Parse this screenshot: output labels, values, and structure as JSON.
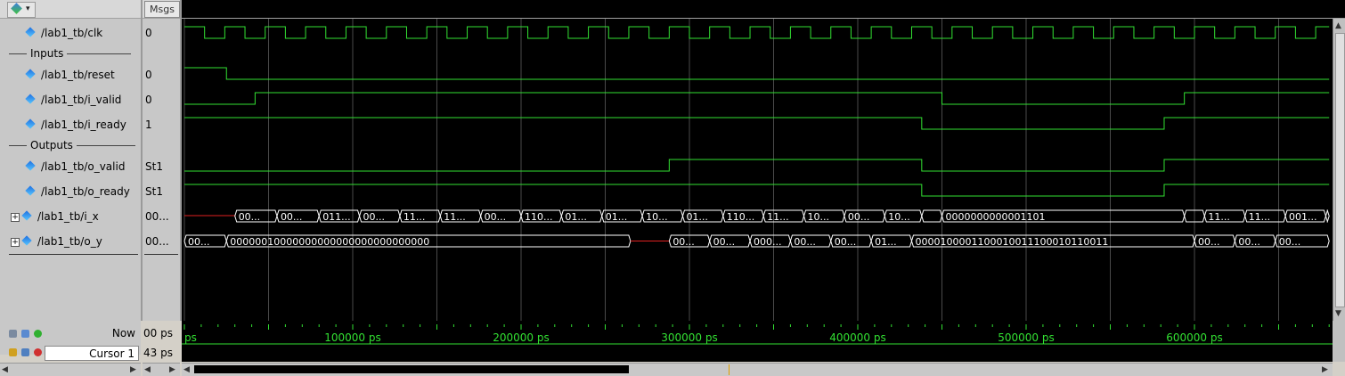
{
  "toolbar": {
    "msgs_header": "Msgs"
  },
  "signals": [
    {
      "name": "/lab1_tb/clk",
      "value": "0",
      "expandable": false
    },
    {
      "name": "/lab1_tb/reset",
      "value": "0",
      "expandable": false
    },
    {
      "name": "/lab1_tb/i_valid",
      "value": "0",
      "expandable": false
    },
    {
      "name": "/lab1_tb/i_ready",
      "value": "1",
      "expandable": false
    },
    {
      "name": "/lab1_tb/o_valid",
      "value": "St1",
      "expandable": false
    },
    {
      "name": "/lab1_tb/o_ready",
      "value": "St1",
      "expandable": false
    },
    {
      "name": "/lab1_tb/i_x",
      "value": "00...",
      "expandable": true
    },
    {
      "name": "/lab1_tb/o_y",
      "value": "00...",
      "expandable": true
    }
  ],
  "dividers": [
    "Inputs",
    "Outputs"
  ],
  "waveforms": {
    "time_end_ps": 680000,
    "colors": {
      "signal": "#32e032",
      "undefined": "#e02020",
      "grid": "#4a4a4a",
      "timeline": "#32e032"
    },
    "reset": [
      [
        0,
        1
      ],
      [
        25000,
        0
      ]
    ],
    "i_valid": [
      [
        0,
        0
      ],
      [
        42000,
        1
      ],
      [
        450000,
        0
      ],
      [
        594000,
        1
      ]
    ],
    "i_ready": [
      [
        0,
        1
      ],
      [
        438000,
        0
      ],
      [
        582000,
        1
      ]
    ],
    "o_valid": [
      [
        0,
        0
      ],
      [
        288000,
        1
      ],
      [
        438000,
        0
      ],
      [
        582000,
        1
      ]
    ],
    "o_ready": [
      [
        0,
        1
      ],
      [
        438000,
        0
      ],
      [
        582000,
        1
      ]
    ],
    "i_x_undefined_until": 30000,
    "i_x": [
      {
        "t": 30000,
        "label": "00..."
      },
      {
        "t": 55000,
        "label": "00..."
      },
      {
        "t": 80000,
        "label": "011..."
      },
      {
        "t": 104000,
        "label": "00..."
      },
      {
        "t": 128000,
        "label": "11..."
      },
      {
        "t": 152000,
        "label": "11..."
      },
      {
        "t": 176000,
        "label": "00..."
      },
      {
        "t": 200000,
        "label": "110..."
      },
      {
        "t": 224000,
        "label": "01..."
      },
      {
        "t": 248000,
        "label": "01..."
      },
      {
        "t": 272000,
        "label": "10..."
      },
      {
        "t": 296000,
        "label": "01..."
      },
      {
        "t": 320000,
        "label": "110..."
      },
      {
        "t": 344000,
        "label": "11..."
      },
      {
        "t": 368000,
        "label": "10..."
      },
      {
        "t": 392000,
        "label": "00..."
      },
      {
        "t": 416000,
        "label": "10..."
      },
      {
        "t": 438000,
        "label": ""
      },
      {
        "t": 450000,
        "label": "0000000000001101"
      },
      {
        "t": 594000,
        "label": ""
      },
      {
        "t": 606000,
        "label": "11..."
      },
      {
        "t": 630000,
        "label": "11..."
      },
      {
        "t": 654000,
        "label": "001..."
      },
      {
        "t": 678000,
        "label": ""
      }
    ],
    "o_y_undefined": [
      265000,
      288000
    ],
    "o_y": [
      {
        "t": 0,
        "label": "00..."
      },
      {
        "t": 25000,
        "label": "00000010000000000000000000000000"
      },
      {
        "t": 288000,
        "label": "00..."
      },
      {
        "t": 312000,
        "label": "00..."
      },
      {
        "t": 336000,
        "label": "000..."
      },
      {
        "t": 360000,
        "label": "00..."
      },
      {
        "t": 384000,
        "label": "00..."
      },
      {
        "t": 408000,
        "label": "01..."
      },
      {
        "t": 432000,
        "label": "00001000011000100111000101100 11"
      },
      {
        "t": 600000,
        "label": "00..."
      },
      {
        "t": 624000,
        "label": "00..."
      },
      {
        "t": 648000,
        "label": "00..."
      }
    ],
    "clock_period_ps": 24000
  },
  "timeline": {
    "ticks": [
      "ps",
      "100000 ps",
      "200000 ps",
      "300000 ps",
      "400000 ps",
      "500000 ps",
      "600000 ps"
    ],
    "tick_values": [
      0,
      100000,
      200000,
      300000,
      400000,
      500000,
      600000
    ]
  },
  "status": {
    "now_label": "Now",
    "now_value": "00 ps",
    "cursor_label": "Cursor 1",
    "cursor_value": "43 ps"
  }
}
